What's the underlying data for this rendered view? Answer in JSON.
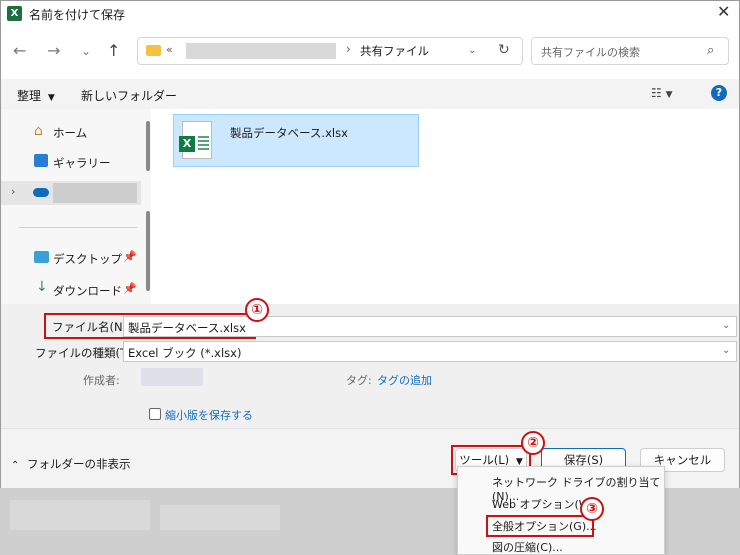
{
  "window": {
    "title": "名前を付けて保存"
  },
  "address": {
    "prefix": "«",
    "current": "共有ファイル"
  },
  "search": {
    "placeholder": "共有ファイルの検索"
  },
  "toolbar": {
    "organize": "整理",
    "new_folder": "新しいフォルダー"
  },
  "nav": {
    "items": [
      {
        "label": "ホーム"
      },
      {
        "label": "ギャラリー"
      },
      {
        "label": "デスクトップ"
      },
      {
        "label": "ダウンロード"
      }
    ]
  },
  "files": [
    {
      "name": "製品データベース.xlsx"
    }
  ],
  "form": {
    "filename_label": "ファイル名(N):",
    "filename_value": "製品データベース.xlsx",
    "filetype_label": "ファイルの種類(T):",
    "filetype_value": "Excel ブック (*.xlsx)",
    "author_label": "作成者:",
    "tag_label": "タグ:",
    "tag_add": "タグの追加",
    "thumbnail_label": "縮小版を保存する"
  },
  "buttons": {
    "hide_folders": "フォルダーの非表示",
    "tools": "ツール(L)",
    "save": "保存(S)",
    "cancel": "キャンセル"
  },
  "tools_menu": [
    {
      "label": "ネットワーク ドライブの割り当て(N)..."
    },
    {
      "label": "Web オプション(W)..."
    },
    {
      "label": "全般オプション(G)..."
    },
    {
      "label": "図の圧縮(C)..."
    }
  ],
  "annotations": {
    "one": "①",
    "two": "②",
    "three": "③"
  }
}
